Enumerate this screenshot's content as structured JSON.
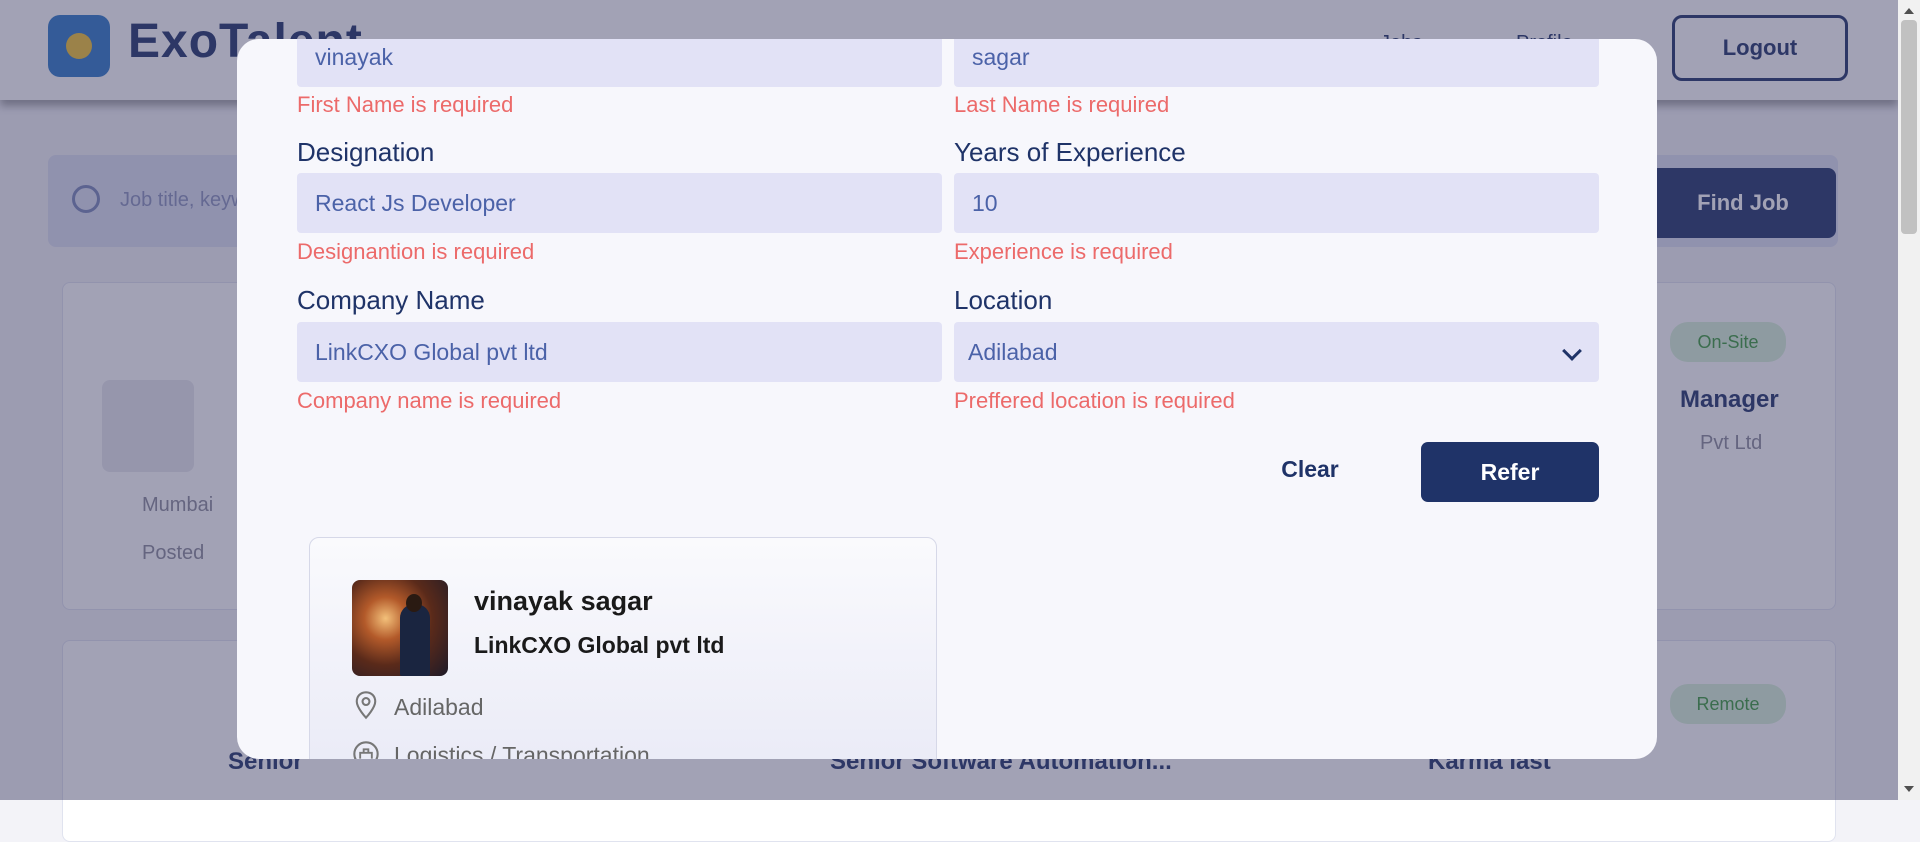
{
  "background": {
    "logo_text": "ExoTalent",
    "nav": [
      "Jobs",
      "Profile"
    ],
    "logout_label": "Logout",
    "search_placeholder": "Job title, keywords",
    "find_job_label": "Find Job",
    "job_cards": [
      {
        "badge": "On-Site",
        "location_hint": "Mumbai",
        "posted_hint": "Posted",
        "title_hint": "Manager",
        "company_hint": "Pvt Ltd"
      },
      {
        "badge": "Remote",
        "title_hint": "Senior",
        "title2_hint": "Senior Software Automation...",
        "title3_hint": "Karma last"
      }
    ]
  },
  "modal": {
    "first_name": {
      "value": "vinayak",
      "error": "First Name is required"
    },
    "last_name": {
      "value": "sagar",
      "error": "Last Name is required"
    },
    "designation": {
      "label": "Designation",
      "value": "React Js Developer",
      "error": "Designantion is required"
    },
    "experience": {
      "label": "Years of Experience",
      "value": "10",
      "error": "Experience is required"
    },
    "company": {
      "label": "Company Name",
      "value": "LinkCXO Global pvt ltd",
      "error": "Company name is required"
    },
    "location": {
      "label": "Location",
      "value": "Adilabad",
      "error": "Preffered location is required"
    },
    "clear_label": "Clear",
    "refer_label": "Refer",
    "preview": {
      "name": "vinayak sagar",
      "company": "LinkCXO Global pvt ltd",
      "location": "Adilabad",
      "industry": "Logistics / Transportation"
    }
  },
  "colors": {
    "primary": "#1f3368",
    "error": "#ec6a6a",
    "input_bg": "#e2e2f6"
  }
}
